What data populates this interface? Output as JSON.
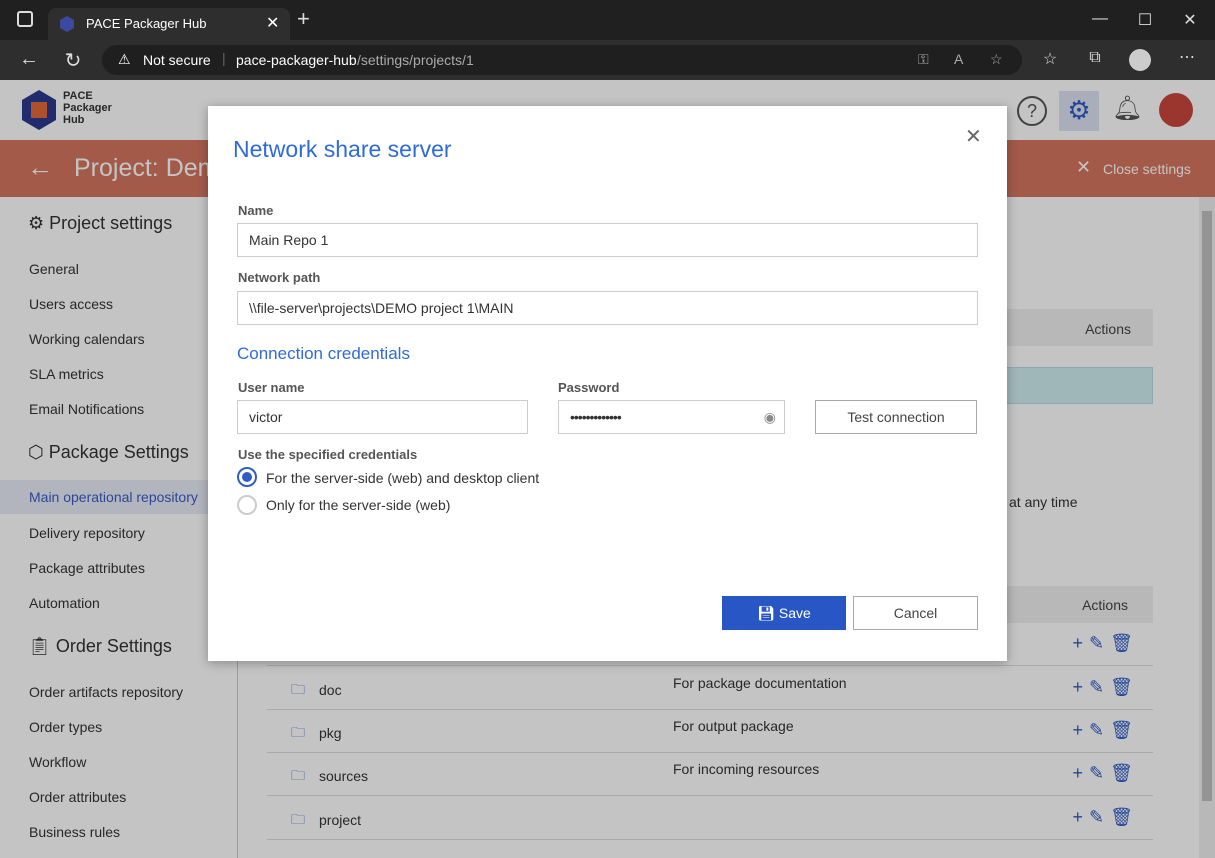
{
  "browser": {
    "tab_title": "PACE Packager Hub",
    "security": "Not secure",
    "url_host": "pace-packager-hub",
    "url_path": "/settings/projects/1"
  },
  "app": {
    "logo_text": [
      "PACE",
      "Packager",
      "Hub"
    ]
  },
  "band": {
    "title": "Project: Dem",
    "close_settings": "Close settings"
  },
  "sidebar": {
    "project_settings": "Project settings",
    "project_items": [
      "General",
      "Users access",
      "Working calendars",
      "SLA metrics",
      "Email Notifications"
    ],
    "package_settings": "Package Settings",
    "package_items": [
      "Main operational repository",
      "Delivery repository",
      "Package attributes",
      "Automation"
    ],
    "order_settings": "Order Settings",
    "order_items": [
      "Order artifacts repository",
      "Order types",
      "Workflow",
      "Order attributes",
      "Business rules"
    ]
  },
  "content": {
    "actions1": "Actions",
    "actions2": "Actions",
    "partial_text": "at any time",
    "folders": [
      {
        "name": "doc",
        "desc": "For package documentation"
      },
      {
        "name": "pkg",
        "desc": "For output package"
      },
      {
        "name": "sources",
        "desc": "For incoming resources"
      },
      {
        "name": "project",
        "desc": ""
      }
    ]
  },
  "modal": {
    "title": "Network share server",
    "name_label": "Name",
    "name_value": "Main Repo 1",
    "path_label": "Network path",
    "path_value": "\\\\file-server\\projects\\DEMO project 1\\MAIN",
    "cred_title": "Connection credentials",
    "user_label": "User name",
    "user_value": "victor",
    "pass_label": "Password",
    "pass_value": "•••••••••••••",
    "test_button": "Test connection",
    "use_label": "Use the specified credentials",
    "radio1": "For the server-side (web) and desktop client",
    "radio2": "Only for the server-side (web)",
    "selected_option": "For the server-side (web) and desktop client",
    "save": "Save",
    "cancel": "Cancel"
  },
  "colors": {
    "accent": "#2f5cc7",
    "band": "#d67560",
    "save_bg": "#2857c5"
  }
}
